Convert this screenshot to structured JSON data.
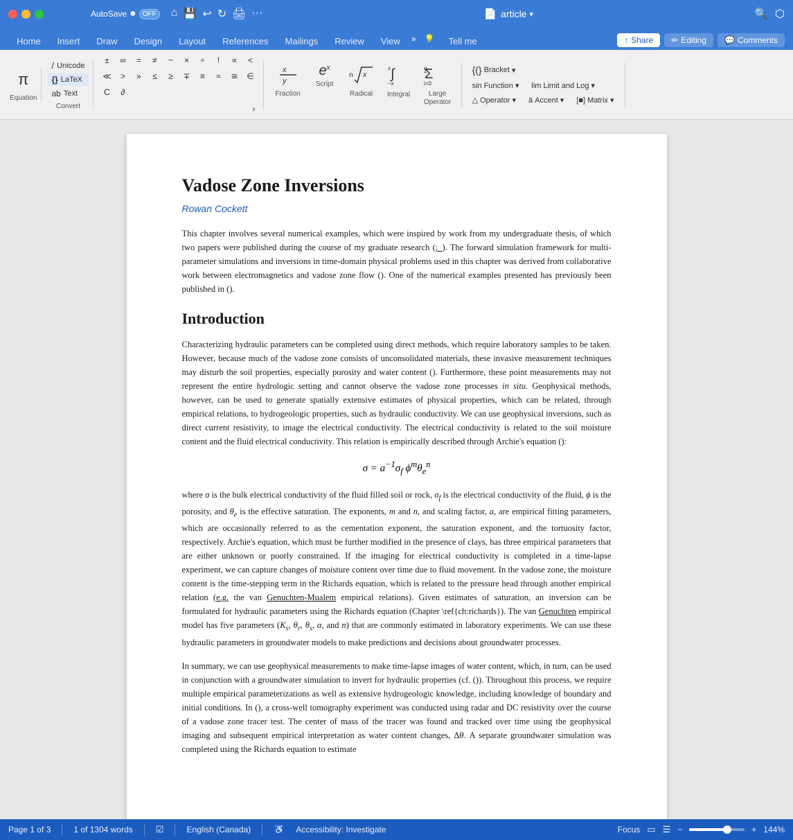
{
  "titlebar": {
    "autosave_label": "AutoSave",
    "autosave_toggle": "OFF",
    "doc_title": "article",
    "more_label": "..."
  },
  "ribbon": {
    "tabs": [
      "Home",
      "Insert",
      "Draw",
      "Design",
      "Layout",
      "References",
      "Mailings",
      "Review",
      "View"
    ],
    "active_tab": "Insert",
    "tell_me": "Tell me",
    "share_label": "Share",
    "editing_label": "Editing",
    "comments_label": "Comments"
  },
  "toolbar": {
    "equation_label": "Equation",
    "unicode_label": "Unicode",
    "latex_label": "LaTeX",
    "text_label": "Text",
    "convert_label": "Convert",
    "symbols": [
      "±",
      "∞",
      "=",
      "≠",
      "~",
      "×",
      "÷",
      "!",
      "∝",
      "<",
      "≪",
      ">",
      ">>",
      "≤",
      "≥",
      "∓",
      "≡",
      "≈",
      "≡",
      "∈",
      "C",
      "∂"
    ],
    "fraction_label": "Fraction",
    "script_label": "Script",
    "radical_label": "Radical",
    "integral_label": "Integral",
    "large_operator_label": "Large\nOperator",
    "bracket_label": "Bracket",
    "function_label": "Function",
    "limit_log_label": "Limit and Log",
    "operator_label": "Operator",
    "accent_label": "Accent",
    "matrix_label": "Matrix"
  },
  "document": {
    "title": "Vadose Zone Inversions",
    "author": "Rowan Cockett",
    "paragraphs": [
      "This chapter involves several numerical examples, which were inspired by work from my undergraduate thesis, of which two papers were published during the course of my graduate research (;_). The forward simulation framework for multi-parameter simulations and inversions in time-domain physical problems used in this chapter was derived from collaborative work between electromagnetics and vadose zone flow (). One of the numerical examples presented has previously been published in ().",
      "Introduction",
      "Characterizing hydraulic parameters can be completed using direct methods, which require laboratory samples to be taken. However, because much of the vadose zone consists of unconsolidated materials, these invasive measurement techniques may disturb the soil properties, especially porosity and water content (). Furthermore, these point measurements may not represent the entire hydrologic setting and cannot observe the vadose zone processes in situ. Geophysical methods, however, can be used to generate spatially extensive estimates of physical properties, which can be related, through empirical relations, to hydrogeologic properties, such as hydraulic conductivity. We can use geophysical inversions, such as direct current resistivity, to image the electrical conductivity. The electrical conductivity is related to the soil moisture content and the fluid electrical conductivity. This relation is empirically described through Archie's equation ():",
      "σ = a⁻¹σ_f ϕ^m θ_e^n",
      "where σ is the bulk electrical conductivity of the fluid filled soil or rock, σ_f is the electrical conductivity of the fluid, ϕ is the porosity, and θ_e is the effective saturation. The exponents, m and n, and scaling factor, a, are empirical fitting parameters, which are occasionally referred to as the cementation exponent, the saturation exponent, and the tortuosity factor, respectively. Archie's equation, which must be further modified in the presence of clays, has three empirical parameters that are either unknown or poorly constrained. If the imaging for electrical conductivity is completed in a time-lapse experiment, we can capture changes of moisture content over time due to fluid movement. In the vadose zone, the moisture content is the time-stepping term in the Richards equation, which is related to the pressure head through another empirical relation (e.g. the van Genuchten-Mualem empirical relations). Given estimates of saturation, an inversion can be formulated for hydraulic parameters using the Richards equation (Chapter \\ref{ch:richards}). The van Genuchten empirical model has five parameters (K_s, θ_r, θ_s, α, and n) that are commonly estimated in laboratory experiments. We can use these hydraulic parameters in groundwater models to make predictions and decisions about groundwater processes.",
      "In summary, we can use geophysical measurements to make time-lapse images of water content, which, in turn, can be used in conjunction with a groundwater simulation to invert for hydraulic properties (cf. ()). Throughout this process, we require multiple empirical parameterizations as well as extensive hydrogeologic knowledge, including knowledge of boundary and initial conditions. In (), a cross-well tomography experiment was conducted using radar and DC resistivity over the course of a vadose zone tracer test. The center of mass of the tracer was found and tracked over time using the geophysical imaging and subsequent empirical interpretation as water content changes, Δθ. A separate groundwater simulation was completed using the Richards equation to estimate"
    ],
    "equation_display": "σ = a⁻¹σ_f ϕᵐθ_eⁿ"
  },
  "statusbar": {
    "page_info": "Page 1 of 3",
    "word_count": "1 of 1304 words",
    "track_changes": "",
    "language": "English (Canada)",
    "accessibility": "Accessibility: Investigate",
    "focus": "Focus",
    "zoom": "144%",
    "zoom_minus": "−",
    "zoom_plus": "+"
  },
  "icons": {
    "close": "✕",
    "minimize": "−",
    "maximize": "□",
    "chevron_down": "▾",
    "share": "↑",
    "editing_pen": "✏",
    "comments_bubble": "💬",
    "search": "🔍",
    "doc": "📄",
    "home_icon": "⌂",
    "undo": "↩",
    "redo": "↻",
    "print": "🖨",
    "more": "···"
  }
}
